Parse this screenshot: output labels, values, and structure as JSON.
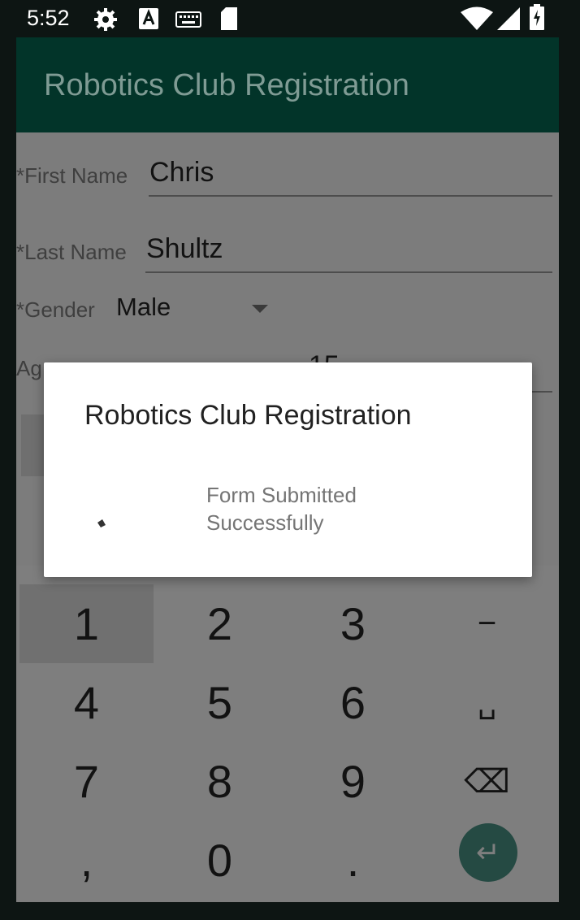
{
  "status_bar": {
    "time": "5:52",
    "icons": [
      "gear-icon",
      "a-icon",
      "keyboard-icon",
      "sd-card-icon",
      "wifi-icon",
      "signal-icon",
      "battery-icon"
    ]
  },
  "app": {
    "title": "Robotics Club Registration",
    "theme_color": "#023429"
  },
  "form": {
    "first_name": {
      "label": "*First Name",
      "value": "Chris"
    },
    "last_name": {
      "label": "*Last Name",
      "value": "Shultz"
    },
    "gender": {
      "label": "*Gender",
      "value": "Male"
    },
    "age": {
      "label": "Ag",
      "value": "15"
    }
  },
  "dialog": {
    "title": "Robotics Club Registration",
    "message": "Form Submitted Successfully",
    "icon": "progress-spinner-icon"
  },
  "keypad": {
    "keys": [
      "1",
      "2",
      "3",
      "−",
      "4",
      "5",
      "6",
      "␣",
      "7",
      "8",
      "9",
      "⌫",
      ",",
      "0",
      ".",
      "↵"
    ],
    "enter_color": "#254a43"
  }
}
